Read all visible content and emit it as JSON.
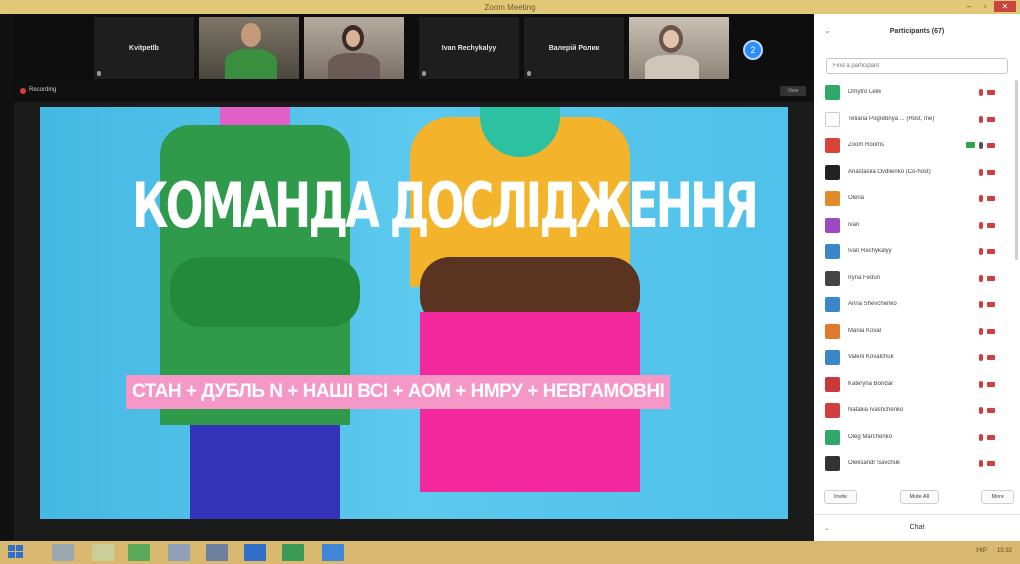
{
  "window": {
    "title": "Zoom Meeting"
  },
  "gallery": {
    "tiles": [
      {
        "kind": "name",
        "name": "Kvitpetlb"
      },
      {
        "kind": "video",
        "label": ""
      },
      {
        "kind": "video",
        "label": ""
      },
      {
        "kind": "name",
        "name": "Ivan Rechykalyy"
      },
      {
        "kind": "name",
        "name": "Валерій Ролик"
      },
      {
        "kind": "video",
        "label": ""
      }
    ],
    "next_page": "2"
  },
  "share": {
    "recording": "Recording",
    "view_options": "View"
  },
  "slide": {
    "title": "КОМАНДА ДОСЛІДЖЕННЯ",
    "subtitle": "СТАН + ДУБЛЬ N + НАШІ ВСІ + АОМ + НМРУ + НЕВГАМОВНІ"
  },
  "participants": {
    "title": "Participants (67)",
    "collapse": "⌄",
    "search_placeholder": "Find a participant",
    "list": [
      {
        "name": "Dmytro Lelik",
        "color": "#2fa86a",
        "cam": "off"
      },
      {
        "name": "Tetiana Pogrebnya ... (Host, me)",
        "color": "#ffffff",
        "cam": "off"
      },
      {
        "name": "Zoom Rooms",
        "color": "#d9433a",
        "cam": "on"
      },
      {
        "name": "Anastasiia Ovdiienko (Co-host)",
        "color": "#222222",
        "cam": "off"
      },
      {
        "name": "Olena",
        "color": "#e08a2c",
        "cam": "off"
      },
      {
        "name": "Ivan",
        "color": "#9b4ac4",
        "cam": "off"
      },
      {
        "name": "Ivan Rechykalyy",
        "color": "#3a86c8",
        "cam": "off"
      },
      {
        "name": "Iryna Fedun",
        "color": "#444444",
        "cam": "off"
      },
      {
        "name": "Anna Shevchenko",
        "color": "#3a86c8",
        "cam": "off"
      },
      {
        "name": "Mariia Koval",
        "color": "#e07a2c",
        "cam": "off"
      },
      {
        "name": "Valerii Kovalchuk",
        "color": "#3a86c8",
        "cam": "off"
      },
      {
        "name": "Kateryna Bondar",
        "color": "#c9383a",
        "cam": "off"
      },
      {
        "name": "Nataliia Ivashchenko",
        "color": "#d13e3e",
        "cam": "off"
      },
      {
        "name": "Oleg Marchenko",
        "color": "#2fa86a",
        "cam": "off"
      },
      {
        "name": "Oleksandr Savchuk",
        "color": "#333333",
        "cam": "off"
      }
    ],
    "buttons": {
      "invite": "Invite",
      "mute_all": "Mute All",
      "more": "More"
    },
    "chat_label": "Chat"
  },
  "taskbar": {
    "time": "15:32",
    "lang": "УКР"
  }
}
